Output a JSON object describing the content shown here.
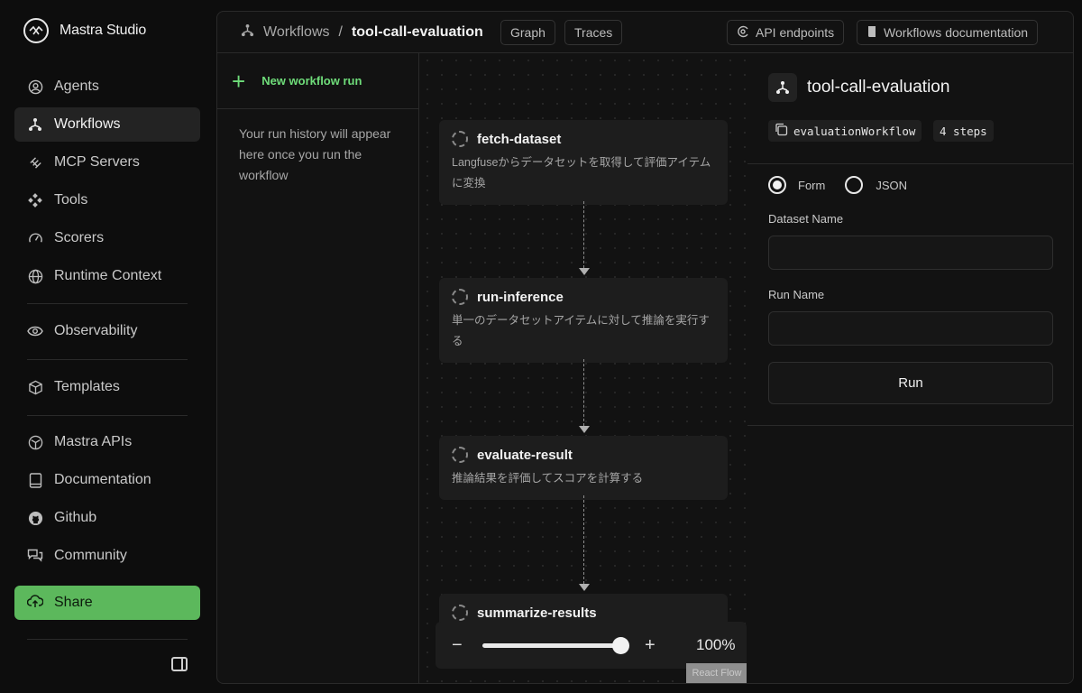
{
  "app": {
    "name": "Mastra Studio"
  },
  "sidebar": {
    "items": [
      {
        "label": "Agents",
        "icon": "agent-icon"
      },
      {
        "label": "Workflows",
        "icon": "workflow-icon",
        "active": true
      },
      {
        "label": "MCP Servers",
        "icon": "mcp-icon"
      },
      {
        "label": "Tools",
        "icon": "tools-icon"
      },
      {
        "label": "Scorers",
        "icon": "gauge-icon"
      },
      {
        "label": "Runtime Context",
        "icon": "globe-icon"
      },
      {
        "label": "Observability",
        "icon": "eye-icon"
      },
      {
        "label": "Templates",
        "icon": "cube-icon"
      },
      {
        "label": "Mastra APIs",
        "icon": "api-icon"
      },
      {
        "label": "Documentation",
        "icon": "book-icon"
      },
      {
        "label": "Github",
        "icon": "github-icon"
      },
      {
        "label": "Community",
        "icon": "chat-icon"
      }
    ],
    "share_label": "Share"
  },
  "header": {
    "crumb_root": "Workflows",
    "crumb_sep": "/",
    "crumb_current": "tool-call-evaluation",
    "tab_graph": "Graph",
    "tab_traces": "Traces",
    "api_endpoints": "API endpoints",
    "docs": "Workflows documentation"
  },
  "runs": {
    "new_label": "New workflow run",
    "empty_text": "Your run history will appear here once you run the workflow"
  },
  "graph": {
    "steps": [
      {
        "name": "fetch-dataset",
        "desc": "Langfuseからデータセットを取得して評価アイテムに変換"
      },
      {
        "name": "run-inference",
        "desc": "単一のデータセットアイテムに対して推論を実行する"
      },
      {
        "name": "evaluate-result",
        "desc": "推論結果を評価してスコアを計算する"
      },
      {
        "name": "summarize-results",
        "desc": ""
      }
    ],
    "zoom": "100%",
    "attribution": "React Flow"
  },
  "panel": {
    "title": "tool-call-evaluation",
    "workflow_id": "evaluationWorkflow",
    "steps_count": "4 steps",
    "mode_form": "Form",
    "mode_json": "JSON",
    "dataset_label": "Dataset Name",
    "dataset_value": "",
    "runname_label": "Run Name",
    "runname_value": "",
    "run_button": "Run"
  },
  "colors": {
    "accent_green": "#5cb85c",
    "new_run_green": "#6fdd7a"
  }
}
